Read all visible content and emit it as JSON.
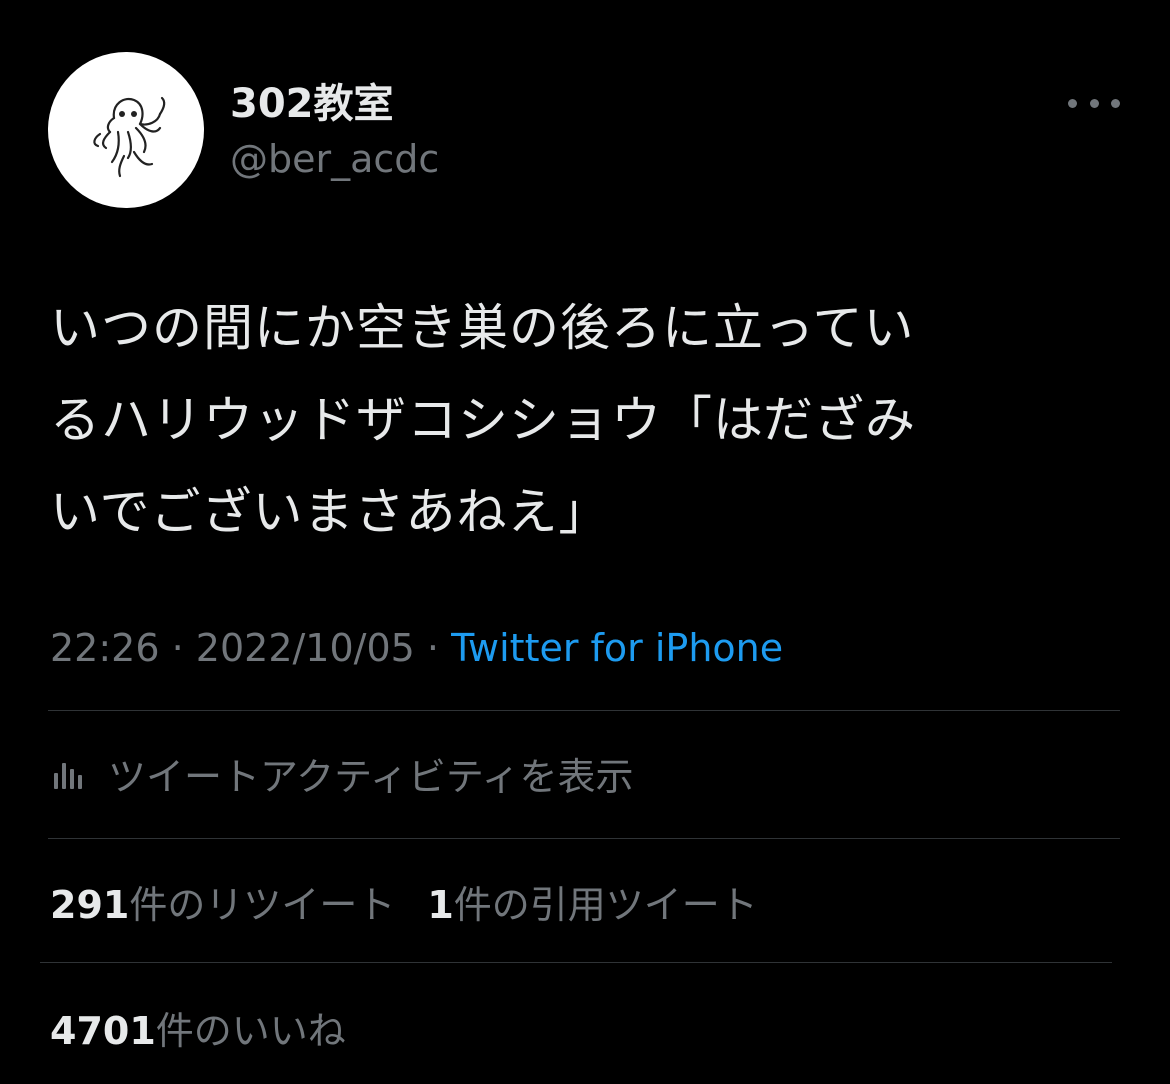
{
  "author": {
    "display_name": "302教室",
    "handle": "@ber_acdc",
    "avatar_icon": "hand-drawn-creature-icon"
  },
  "more_icon": "more-options-icon",
  "tweet": {
    "text_lines": [
      "いつの間にか空き巣の後ろに立ってい",
      "るハリウッドザコシショウ「はだざみ",
      "いでございまさあねえ」"
    ]
  },
  "meta": {
    "time": "22:26",
    "separator": "·",
    "date": "2022/10/05",
    "source": "Twitter for iPhone"
  },
  "activity": {
    "icon": "bar-chart-icon",
    "label": "ツイートアクティビティを表示"
  },
  "stats": {
    "retweets": {
      "count": "291",
      "label": "件のリツイート"
    },
    "quotes": {
      "count": "1",
      "label": "件の引用ツイート"
    },
    "likes": {
      "count": "4701",
      "label": "件のいいね"
    }
  },
  "colors": {
    "background": "#000000",
    "primary_text": "#e7e9ea",
    "secondary_text": "#71767b",
    "link": "#1d9bf0",
    "divider": "#2f3336"
  }
}
